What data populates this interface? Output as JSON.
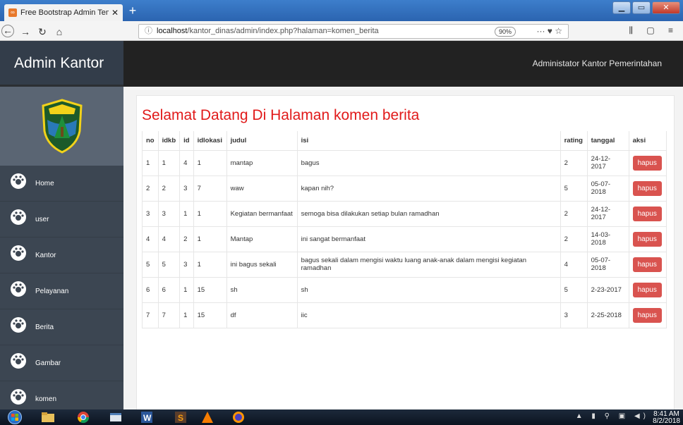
{
  "browser": {
    "tab_title": "Free Bootstrap Admin Templat",
    "tab_close": "✕",
    "new_tab": "+",
    "url_host": "localhost",
    "url_path": "/kantor_dinas/admin/index.php?halaman=komen_berita",
    "zoom": "90%",
    "info_icon": "ⓘ",
    "url_icons": "··· ♥ ☆",
    "tools": "⫼ ▢ ≡"
  },
  "app": {
    "brand": "Admin Kantor",
    "user_label": "Administator Kantor Pemerintahan"
  },
  "sidebar": {
    "items": [
      {
        "label": "Home"
      },
      {
        "label": "user"
      },
      {
        "label": "Kantor"
      },
      {
        "label": "Pelayanan"
      },
      {
        "label": "Berita"
      },
      {
        "label": "Gambar"
      },
      {
        "label": "komen"
      }
    ]
  },
  "main": {
    "title": "Selamat Datang Di Halaman komen berita",
    "columns": [
      "no",
      "idkb",
      "id",
      "idlokasi",
      "judul",
      "isi",
      "rating",
      "tanggal",
      "aksi"
    ],
    "rows": [
      [
        "1",
        "1",
        "4",
        "1",
        "mantap",
        "bagus",
        "2",
        "24-12-2017",
        "hapus"
      ],
      [
        "2",
        "2",
        "3",
        "7",
        "waw",
        "kapan nih?",
        "5",
        "05-07-2018",
        "hapus"
      ],
      [
        "3",
        "3",
        "1",
        "1",
        "Kegiatan bermanfaat",
        "semoga bisa dilakukan setiap bulan ramadhan",
        "2",
        "24-12-2017",
        "hapus"
      ],
      [
        "4",
        "4",
        "2",
        "1",
        "Mantap",
        "ini sangat bermanfaat",
        "2",
        "14-03-2018",
        "hapus"
      ],
      [
        "5",
        "5",
        "3",
        "1",
        "ini bagus sekali",
        "bagus sekali dalam mengisi waktu luang anak-anak dalam mengisi kegiatan ramadhan",
        "4",
        "05-07-2018",
        "hapus"
      ],
      [
        "6",
        "6",
        "1",
        "15",
        "sh",
        "sh",
        "5",
        "2-23-2017",
        "hapus"
      ],
      [
        "7",
        "7",
        "1",
        "15",
        "df",
        "iic",
        "3",
        "2-25-2018",
        "hapus"
      ]
    ]
  },
  "taskbar": {
    "time": "8:41 AM",
    "date": "8/2/2018"
  },
  "colors": {
    "title_red": "#e11a1a",
    "button_red": "#d9534f",
    "sidebar_bg": "#3c4652",
    "header_bg": "#222222"
  }
}
